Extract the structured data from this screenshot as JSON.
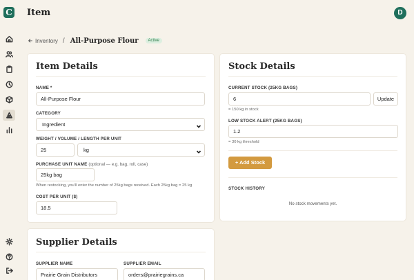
{
  "app": {
    "logo_letter": "C",
    "page_title": "Item",
    "user_initial": "D"
  },
  "nav": [
    "home-icon",
    "users-icon",
    "clipboard-icon",
    "clock-icon",
    "box-icon",
    "ingredients-icon",
    "chart-icon"
  ],
  "nav_bottom": [
    "gear-icon",
    "help-icon",
    "logout-icon"
  ],
  "breadcrumb": {
    "back_label": "Inventory",
    "separator": "/",
    "current": "All-Purpose Flour",
    "status": "Active"
  },
  "item_details": {
    "title": "Item Details",
    "name_label": "NAME *",
    "name_value": "All-Purpose Flour",
    "category_label": "CATEGORY",
    "category_value": "Ingredient",
    "weight_label": "WEIGHT / VOLUME / LENGTH PER UNIT",
    "weight_value": "25",
    "unit_value": "kg",
    "purchase_label": "PURCHASE UNIT NAME",
    "purchase_optional": "(optional — e.g. bag, roll, case)",
    "purchase_value": "25kg bag",
    "restock_hint": "When restocking, you'll enter the number of 25kg bags received. Each 25kg bag = 25 kg",
    "cost_label": "COST PER UNIT ($)",
    "cost_value": "18.5"
  },
  "stock_details": {
    "title": "Stock Details",
    "current_label": "CURRENT STOCK (25KG BAGS)",
    "current_value": "6",
    "update_label": "Update",
    "current_hint": "= 150 kg in stock",
    "alert_label": "LOW STOCK ALERT (25KG BAGS)",
    "alert_value": "1.2",
    "alert_hint": "= 30 kg threshold",
    "add_label": "Add Stock",
    "history_label": "STOCK HISTORY",
    "history_empty": "No stock movements yet."
  },
  "supplier_details": {
    "title": "Supplier Details",
    "name_label": "SUPPLIER NAME",
    "name_value": "Prairie Grain Distributors",
    "email_label": "SUPPLIER EMAIL",
    "email_value": "orders@prairiegrains.ca"
  },
  "colors": {
    "brand": "#1f6f5c",
    "accent": "#d39a3f",
    "background": "#f6f2ea"
  }
}
